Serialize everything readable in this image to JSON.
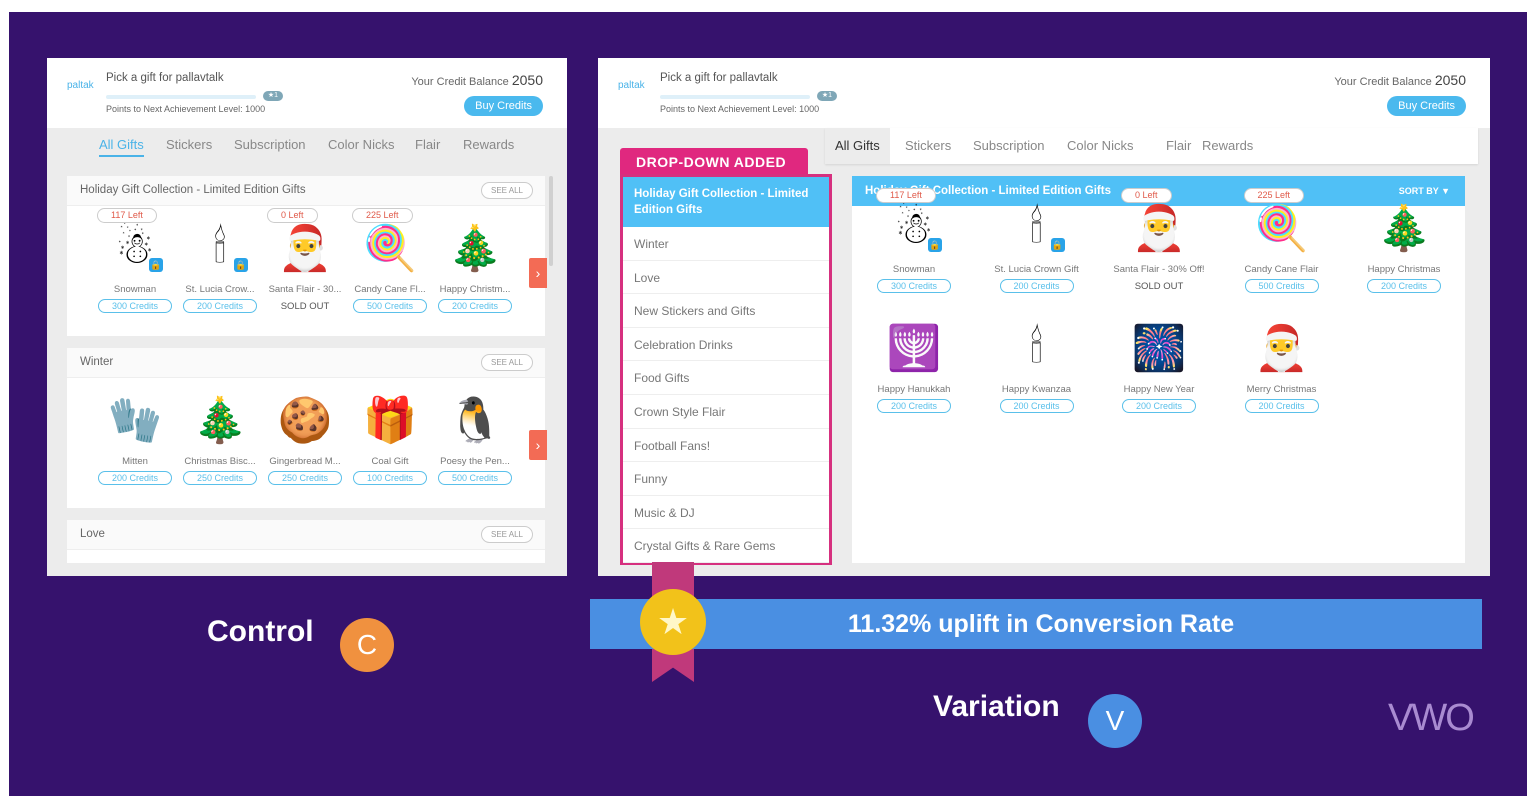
{
  "header": {
    "logo": "paltak",
    "pick_text": "Pick a gift for pallavtalk",
    "level_badge": "★1",
    "points_text": "Points to Next Achievement Level: 1000",
    "credit_label": "Your Credit Balance",
    "credit_value": "2050",
    "buy_button": "Buy Credits"
  },
  "tabs": [
    "All Gifts",
    "Stickers",
    "Subscription",
    "Color Nicks",
    "Flair",
    "Rewards"
  ],
  "control": {
    "see_all": "SEE ALL",
    "sections": [
      {
        "title": "Holiday Gift Collection - Limited Edition Gifts",
        "items": [
          {
            "name": "Snowman",
            "price": "300 Credits",
            "badge": "117 Left",
            "icon": "☃",
            "locked": true
          },
          {
            "name": "St. Lucia Crow...",
            "price": "200 Credits",
            "icon": "🕯",
            "locked": true
          },
          {
            "name": "Santa Flair - 30...",
            "sold": "SOLD OUT",
            "badge": "0 Left",
            "icon": "🎅"
          },
          {
            "name": "Candy Cane Fl...",
            "price": "500 Credits",
            "badge": "225 Left",
            "icon": "🍭"
          },
          {
            "name": "Happy Christm...",
            "price": "200 Credits",
            "icon": "🎄"
          }
        ]
      },
      {
        "title": "Winter",
        "items": [
          {
            "name": "Mitten",
            "price": "200 Credits",
            "icon": "🧤"
          },
          {
            "name": "Christmas Bisc...",
            "price": "250 Credits",
            "icon": "🎄"
          },
          {
            "name": "Gingerbread M...",
            "price": "250 Credits",
            "icon": "🍪"
          },
          {
            "name": "Coal Gift",
            "price": "100 Credits",
            "icon": "🎁"
          },
          {
            "name": "Poesy the Pen...",
            "price": "500 Credits",
            "icon": "🐧"
          }
        ]
      },
      {
        "title": "Love",
        "items": []
      }
    ],
    "label": "Control",
    "badge": "C",
    "badge_color": "#f0913f"
  },
  "variation": {
    "annotation": "DROP-DOWN ADDED",
    "dropdown": {
      "selected": "Holiday Gift Collection - Limited Edition Gifts",
      "items": [
        "Winter",
        "Love",
        "New Stickers and Gifts",
        "Celebration Drinks",
        "Food Gifts",
        "Crown Style Flair",
        "Football Fans!",
        "Funny",
        "Music & DJ",
        "Crystal Gifts & Rare Gems"
      ]
    },
    "main_title": "Holiday Gift Collection - Limited Edition Gifts",
    "sort_by": "SORT BY ▼",
    "items": [
      {
        "name": "Snowman",
        "price": "300 Credits",
        "badge": "117 Left",
        "icon": "☃",
        "locked": true
      },
      {
        "name": "St. Lucia Crown Gift",
        "price": "200 Credits",
        "icon": "🕯",
        "locked": true
      },
      {
        "name": "Santa Flair - 30% Off!",
        "sold": "SOLD OUT",
        "badge": "0 Left",
        "icon": "🎅"
      },
      {
        "name": "Candy Cane Flair",
        "price": "500 Credits",
        "badge": "225 Left",
        "icon": "🍭"
      },
      {
        "name": "Happy Christmas",
        "price": "200 Credits",
        "icon": "🎄"
      },
      {
        "name": "Happy Hanukkah",
        "price": "200 Credits",
        "icon": "🕎"
      },
      {
        "name": "Happy Kwanzaa",
        "price": "200 Credits",
        "icon": "🕯"
      },
      {
        "name": "Happy New Year",
        "price": "200 Credits",
        "icon": "🎆"
      },
      {
        "name": "Merry Christmas",
        "price": "200 Credits",
        "icon": "🎅"
      }
    ],
    "uplift": "11.32% uplift in Conversion Rate",
    "label": "Variation",
    "badge": "V",
    "badge_color": "#4a8fe2"
  },
  "brand": "VWO"
}
